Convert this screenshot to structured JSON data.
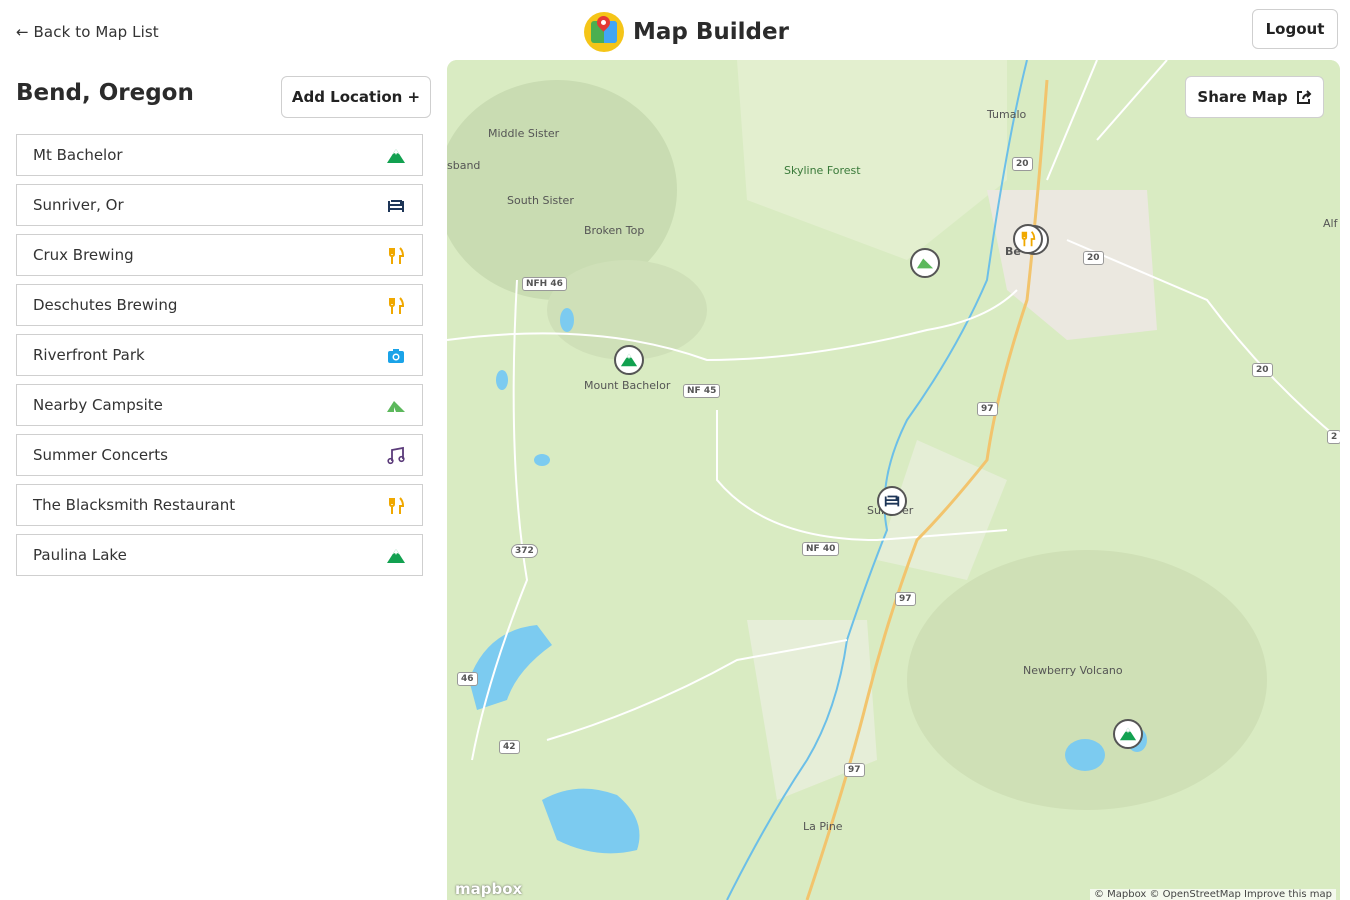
{
  "topbar": {
    "back_link": "← Back to Map List",
    "app_title": "Map Builder",
    "logout_label": "Logout"
  },
  "sidebar": {
    "map_title": "Bend, Oregon",
    "add_location_label": "Add Location +",
    "locations": [
      {
        "name": "Mt Bachelor",
        "icon": "mountain-icon",
        "color": "#12a150"
      },
      {
        "name": "Sunriver, Or",
        "icon": "bed-icon",
        "color": "#1d3557"
      },
      {
        "name": "Crux Brewing",
        "icon": "utensils-icon",
        "color": "#f0a800"
      },
      {
        "name": "Deschutes Brewing",
        "icon": "utensils-icon",
        "color": "#f0a800"
      },
      {
        "name": "Riverfront Park",
        "icon": "camera-icon",
        "color": "#1aa3e8"
      },
      {
        "name": "Nearby Campsite",
        "icon": "tent-icon",
        "color": "#5cb85c"
      },
      {
        "name": "Summer Concerts",
        "icon": "music-icon",
        "color": "#5b3b7a"
      },
      {
        "name": "The Blacksmith Restaurant",
        "icon": "utensils-icon",
        "color": "#f0a800"
      },
      {
        "name": "Paulina Lake",
        "icon": "mountain-icon",
        "color": "#12a150"
      }
    ]
  },
  "map": {
    "share_label": "Share Map",
    "labels": {
      "tumalo": "Tumalo",
      "middle_sister": "Middle Sister",
      "sband": "sband",
      "south_sister": "South Sister",
      "broken_top": "Broken Top",
      "skyline_forest": "Skyline Forest",
      "mount_bachelor": "Mount Bachelor",
      "sunriver": "Sunriver",
      "newberry_volcano": "Newberry Volcano",
      "la_pine": "La Pine",
      "alf": "Alf",
      "bend": "Be"
    },
    "shields": {
      "nfh46": "NFH 46",
      "nf45": "NF 45",
      "nf40": "NF 40",
      "r372": "372",
      "r46": "46",
      "r42": "42",
      "r97a": "97",
      "r97b": "97",
      "r97c": "97",
      "r20a": "20",
      "r20b": "20",
      "r20c": "20",
      "r2": "2"
    },
    "attribution": "© Mapbox © OpenStreetMap Improve this map",
    "mapbox_logo": "mapbox",
    "colors": {
      "land": "#d9ebc2",
      "water": "#7ccbf0",
      "urban": "#ebe8e0",
      "road": "#ffffff",
      "highway": "#f2c46d"
    }
  }
}
